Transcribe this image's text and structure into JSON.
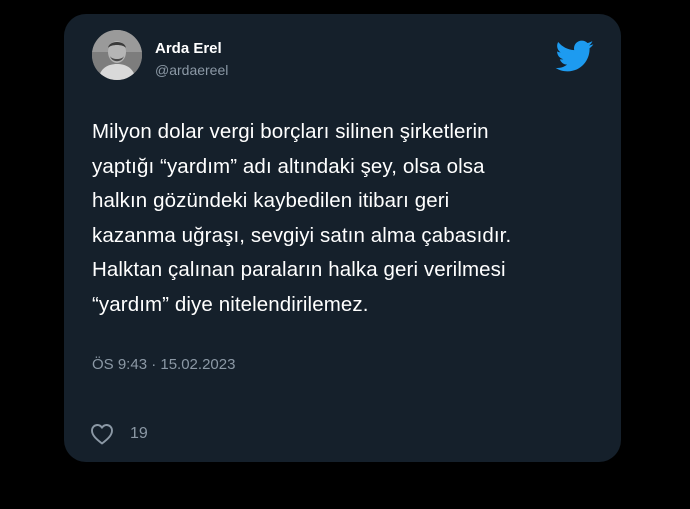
{
  "author": {
    "display_name": "Arda Erel",
    "handle": "@ardaereel"
  },
  "tweet": {
    "text": "Milyon dolar vergi borçları silinen şirketlerin\nyaptığı “yardım” adı altındaki şey, olsa olsa\nhalkın gözündeki kaybedilen itibarı geri\nkazanma uğraşı, sevgiyi satın alma çabasıdır.\nHalktan çalınan paraların halka geri verilmesi\n“yardım” diye nitelendirilemez.",
    "timestamp": "ÖS 9:43 · 15.02.2023",
    "likes": "19"
  },
  "icons": {
    "brand": "twitter-bird-icon",
    "like": "heart-icon"
  },
  "colors": {
    "background": "#000000",
    "card": "#15202b",
    "text": "#ffffff",
    "secondary_text": "#8b98a5",
    "twitter_blue": "#1d9bf0"
  }
}
